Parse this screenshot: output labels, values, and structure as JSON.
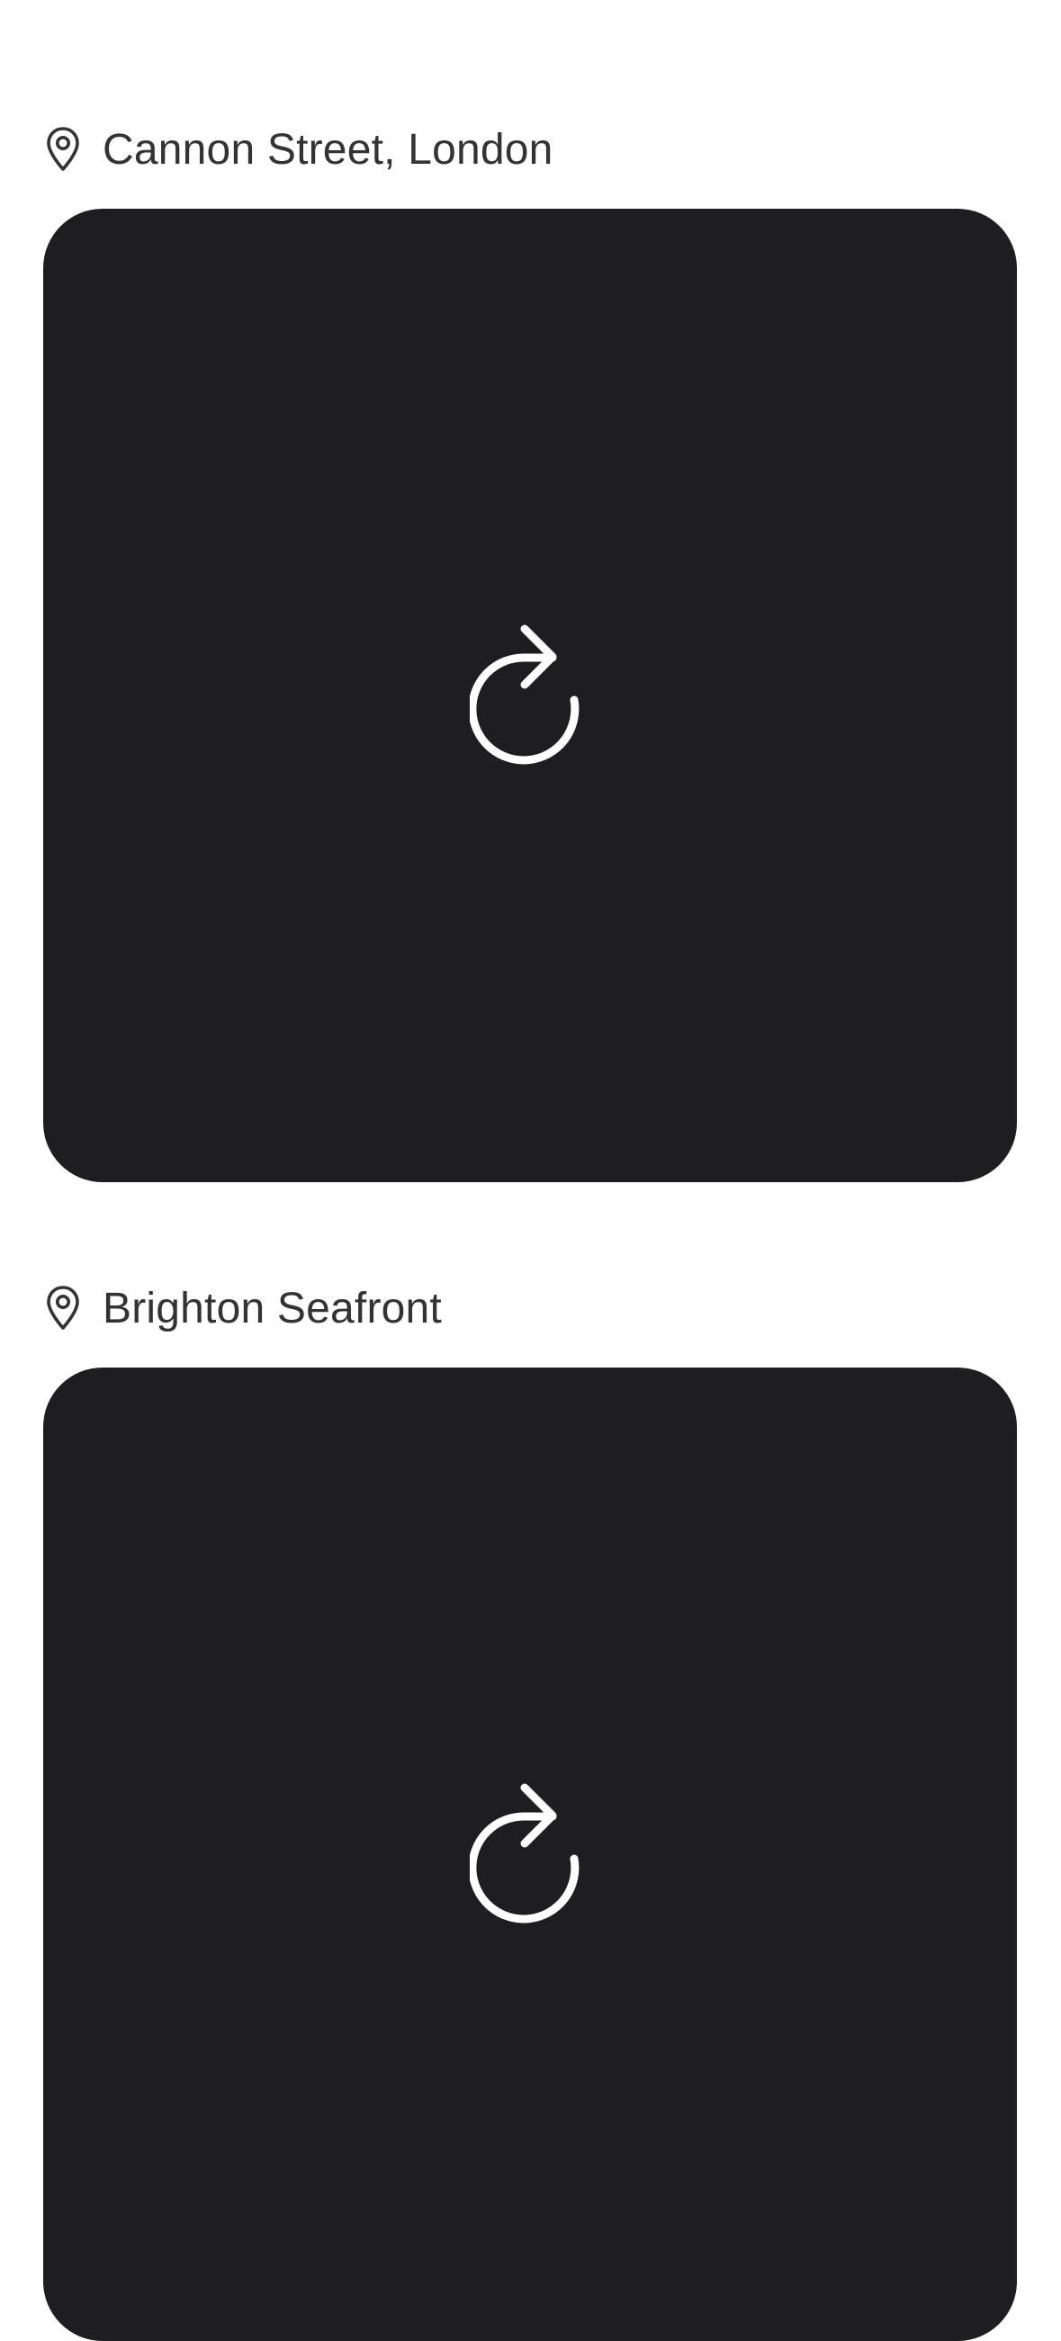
{
  "feed": {
    "posts": [
      {
        "location": "Cannon Street, London",
        "location_icon": "map-pin-icon",
        "media_icon": "reload-icon",
        "media_background": "#1e1e20"
      },
      {
        "location": "Brighton Seafront",
        "location_icon": "map-pin-icon",
        "media_icon": "reload-icon",
        "media_background": "#1e1e20"
      }
    ]
  },
  "colors": {
    "page_background": "#ffffff",
    "text": "#333333",
    "card": "#1e1e20",
    "icon_on_card": "#ffffff"
  }
}
